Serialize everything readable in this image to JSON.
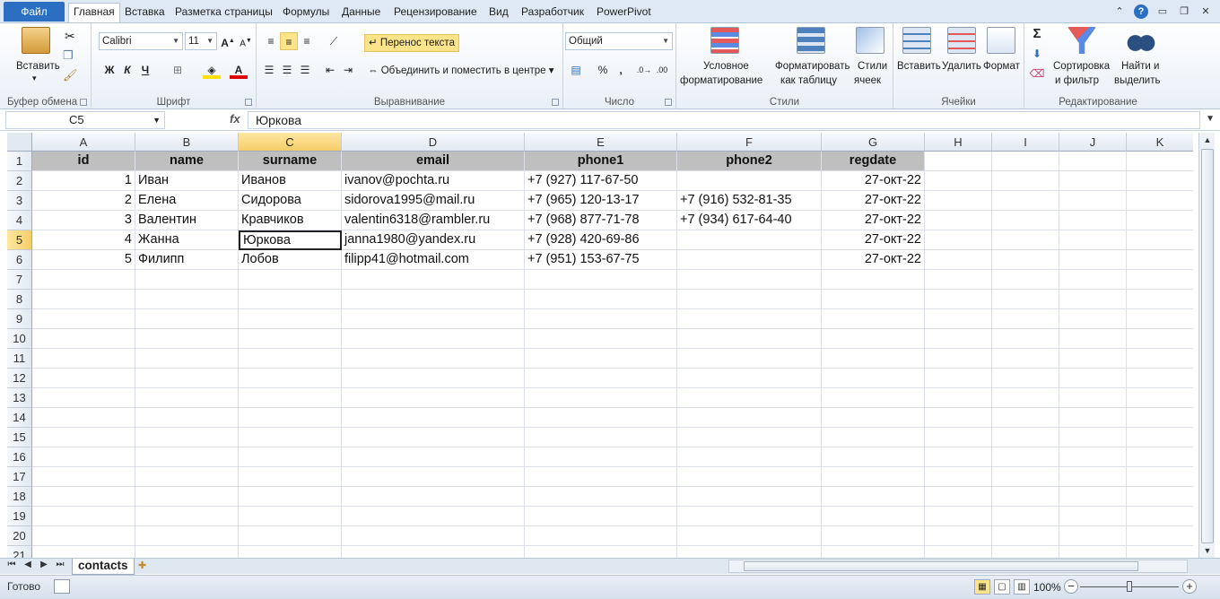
{
  "ribbon": {
    "tabs": [
      "Файл",
      "Главная",
      "Вставка",
      "Разметка страницы",
      "Формулы",
      "Данные",
      "Рецензирование",
      "Вид",
      "Разработчик",
      "PowerPivot"
    ],
    "clipboard": {
      "paste": "Вставить",
      "label": "Буфер обмена"
    },
    "font": {
      "name": "Calibri",
      "size": "11",
      "bold": "Ж",
      "italic": "К",
      "underline": "Ч",
      "label": "Шрифт"
    },
    "alignment": {
      "wrap": "Перенос текста",
      "merge": "Объединить и поместить в центре",
      "label": "Выравнивание"
    },
    "number": {
      "format": "Общий",
      "percent": "%",
      "comma": ",",
      "label": "Число"
    },
    "styles": {
      "conditional_1": "Условное",
      "conditional_2": "форматирование",
      "table_1": "Форматировать",
      "table_2": "как таблицу",
      "cell_1": "Стили",
      "cell_2": "ячеек",
      "label": "Стили"
    },
    "cells": {
      "insert": "Вставить",
      "delete": "Удалить",
      "format": "Формат",
      "label": "Ячейки"
    },
    "editing": {
      "sum": "Σ",
      "sort_1": "Сортировка",
      "sort_2": "и фильтр",
      "find_1": "Найти и",
      "find_2": "выделить",
      "label": "Редактирование"
    }
  },
  "formula_bar": {
    "name_box": "C5",
    "fx": "fx",
    "content": "Юркова"
  },
  "grid": {
    "columns": [
      "A",
      "B",
      "C",
      "D",
      "E",
      "F",
      "G",
      "H",
      "I",
      "J",
      "K"
    ],
    "rows": [
      "1",
      "2",
      "3",
      "4",
      "5",
      "6",
      "7",
      "8",
      "9",
      "10",
      "11",
      "12",
      "13",
      "14",
      "15",
      "16",
      "17",
      "18",
      "19",
      "20",
      "21"
    ],
    "headers": [
      "id",
      "name",
      "surname",
      "email",
      "phone1",
      "phone2",
      "regdate"
    ],
    "data": [
      [
        "1",
        "Иван",
        "Иванов",
        "ivanov@pochta.ru",
        "+7 (927) 117-67-50",
        "",
        "27-окт-22"
      ],
      [
        "2",
        "Елена",
        "Сидорова",
        "sidorova1995@mail.ru",
        "+7 (965) 120-13-17",
        "+7 (916) 532-81-35",
        "27-окт-22"
      ],
      [
        "3",
        "Валентин",
        "Кравчиков",
        "valentin6318@rambler.ru",
        "+7 (968) 877-71-78",
        "+7 (934) 617-64-40",
        "27-окт-22"
      ],
      [
        "4",
        "Жанна",
        "Юркова",
        "janna1980@yandex.ru",
        "+7 (928) 420-69-86",
        "",
        "27-окт-22"
      ],
      [
        "5",
        "Филипп",
        "Лобов",
        "filipp41@hotmail.com",
        "+7 (951) 153-67-75",
        "",
        "27-окт-22"
      ]
    ],
    "active_cell": "C5"
  },
  "sheets": {
    "active": "contacts"
  },
  "status": {
    "ready": "Готово",
    "zoom": "100%"
  },
  "colors": {
    "file_tab": "#2a6fc2",
    "header_fill": "#bfbfbf",
    "selection": "#f6cd68"
  }
}
